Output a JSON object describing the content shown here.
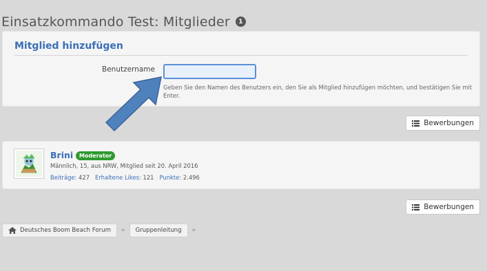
{
  "page": {
    "title": "Einsatzkommando Test: Mitglieder",
    "badge_count": "1"
  },
  "add_member": {
    "heading": "Mitglied hinzufügen",
    "field_label": "Benutzername",
    "input_value": "",
    "hint": "Geben Sie den Namen des Benutzers ein, den Sie als Mitglied hinzufügen möchten, und bestätigen Sie mit Enter."
  },
  "buttons": {
    "applications_label": "Bewerbungen"
  },
  "member": {
    "name": "Brini",
    "role": "Moderator",
    "info": "Männlich, 15, aus NRW, Mitglied seit 20. April 2016",
    "stats": [
      {
        "label": "Beiträge:",
        "value": "427"
      },
      {
        "label": "Erhaltene Likes:",
        "value": "121"
      },
      {
        "label": "Punkte:",
        "value": "2.496"
      }
    ]
  },
  "breadcrumb": [
    {
      "label": "Deutsches Boom Beach Forum",
      "icon": "home-icon"
    },
    {
      "label": "Gruppenleitung"
    }
  ],
  "colors": {
    "link": "#3b6fb6",
    "badge_green": "#2f9a2f",
    "arrow_blue": "#4f81bd"
  }
}
